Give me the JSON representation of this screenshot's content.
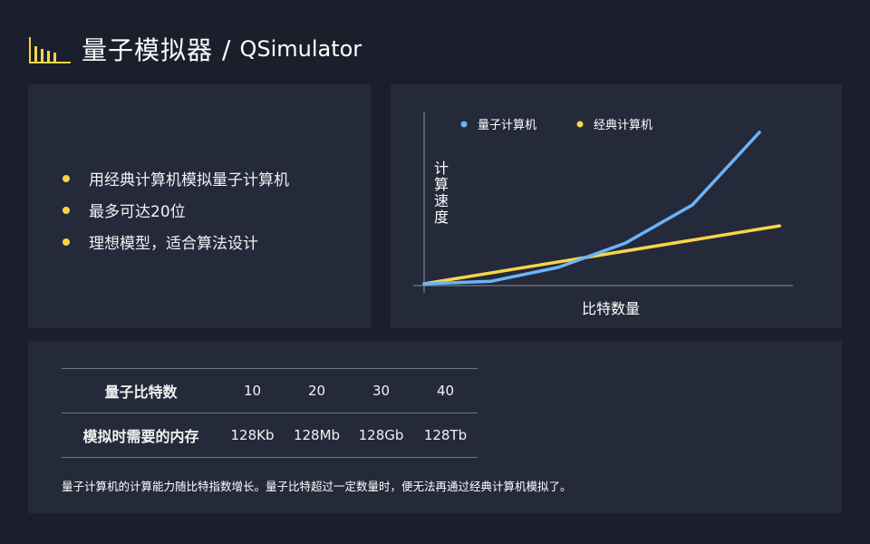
{
  "header": {
    "icon": "bar-chart-icon",
    "title_cn": "量子模拟器",
    "separator": "/",
    "title_en": "QSimulator"
  },
  "colors": {
    "background": "#1b1f2c",
    "panel": "#242a3a",
    "accent_yellow": "#f7d54a",
    "series_blue": "#6cb3f7"
  },
  "bullets": [
    "用经典计算机模拟量子计算机",
    "最多可达20位",
    "理想模型，适合算法设计"
  ],
  "chart_data": {
    "type": "line",
    "title": "",
    "xlabel": "比特数量",
    "ylabel": "计算速度",
    "grid": false,
    "legend_position": "top-left",
    "series": [
      {
        "name": "量子计算机",
        "color": "#6cb3f7",
        "x": [
          0,
          1,
          2,
          3,
          4,
          5
        ],
        "values": [
          0.5,
          2,
          10,
          24,
          46,
          88
        ]
      },
      {
        "name": "经典计算机",
        "color": "#f7d54a",
        "x": [
          0,
          5.3
        ],
        "values": [
          0.5,
          34
        ]
      }
    ],
    "xlim": [
      0,
      5.5
    ],
    "ylim": [
      0,
      100
    ]
  },
  "table": {
    "row_headers": [
      "量子比特数",
      "模拟时需要的内存"
    ],
    "qubits": [
      "10",
      "20",
      "30",
      "40"
    ],
    "memory": [
      "128Kb",
      "128Mb",
      "128Gb",
      "128Tb"
    ],
    "note": "量子计算机的计算能力随比特指数增长。量子比特超过一定数量时，便无法再通过经典计算机模拟了。"
  }
}
